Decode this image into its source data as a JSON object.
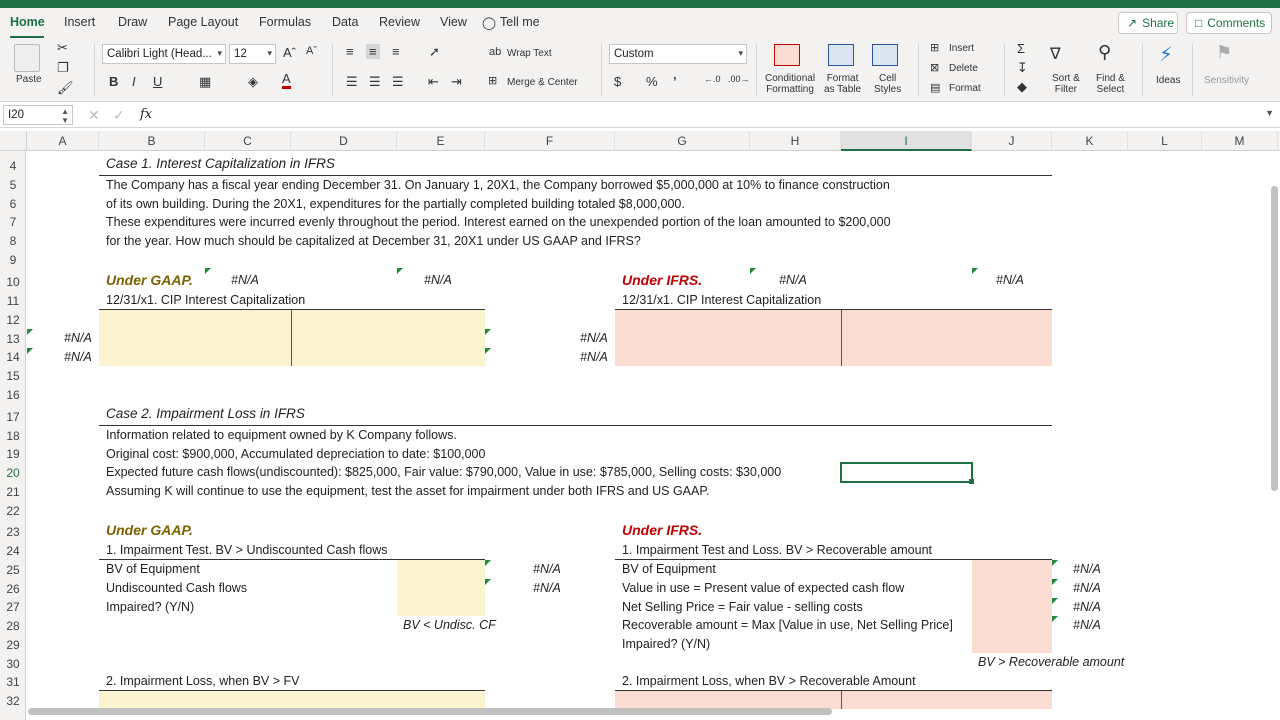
{
  "ribbon_tabs": [
    "Home",
    "Insert",
    "Draw",
    "Page Layout",
    "Formulas",
    "Data",
    "Review",
    "View"
  ],
  "tell_me": "Tell me",
  "share_label": "Share",
  "comments_label": "Comments",
  "ribbon": {
    "paste": "Paste",
    "font_name": "Calibri Light (Head...",
    "font_size": "12",
    "wrap_text": "Wrap Text",
    "merge_center": "Merge & Center",
    "number_format": "Custom",
    "conditional_formatting": [
      "Conditional",
      "Formatting"
    ],
    "format_as_table": [
      "Format",
      "as Table"
    ],
    "cell_styles": [
      "Cell",
      "Styles"
    ],
    "insert": "Insert",
    "delete": "Delete",
    "format": "Format",
    "sort_filter": [
      "Sort &",
      "Filter"
    ],
    "find_select": [
      "Find &",
      "Select"
    ],
    "ideas": "Ideas",
    "sensitivity": "Sensitivity"
  },
  "name_box": "I20",
  "fx": "fx",
  "columns": [
    "A",
    "B",
    "C",
    "D",
    "E",
    "F",
    "G",
    "H",
    "I",
    "J",
    "K",
    "L",
    "M"
  ],
  "rows": [
    "4",
    "5",
    "6",
    "7",
    "8",
    "9",
    "10",
    "11",
    "12",
    "13",
    "14",
    "15",
    "16",
    "17",
    "18",
    "19",
    "20",
    "21",
    "22",
    "23",
    "24",
    "25",
    "26",
    "27",
    "28",
    "29",
    "30",
    "31",
    "32"
  ],
  "sheet": {
    "case1_title": "Case 1. Interest Capitalization in IFRS",
    "case1_lines": [
      "The Company has a fiscal year ending December 31. On January 1, 20X1, the Company borrowed $5,000,000 at 10% to finance construction",
      "of its own building. During the 20X1, expenditures for the partially completed building totaled $8,000,000.",
      "These expenditures were incurred evenly throughout the period. Interest earned on the unexpended portion of the loan amounted to $200,000",
      "for the year. How much should be capitalized at December 31, 20X1 under US GAAP and IFRS?"
    ],
    "under_gaap": "Under GAAP.",
    "under_ifrs": "Under IFRS.",
    "na": "#N/A",
    "cip_label": "12/31/x1. CIP Interest Capitalization",
    "case2_title": "Case 2. Impairment Loss in IFRS",
    "case2_lines": [
      "Information related to equipment owned by K Company follows.",
      "Original cost: $900,000, Accumulated depreciation to date: $100,000",
      "Expected future cash flows(undiscounted): $825,000, Fair value: $790,000, Value in use: $785,000, Selling costs: $30,000",
      "Assuming K will continue to use the equipment, test the asset for impairment under both IFRS and US GAAP."
    ],
    "gaap_test_title": "1. Impairment Test. BV > Undiscounted Cash flows",
    "gaap_test_rows": [
      "BV of Equipment",
      "Undiscounted Cash flows",
      "Impaired? (Y/N)"
    ],
    "gaap_note": "BV < Undisc. CF",
    "ifrs_test_title": "1. Impairment Test and Loss. BV > Recoverable amount",
    "ifrs_test_rows": [
      "BV of Equipment",
      "Value in use = Present value of expected cash flow",
      "Net Selling Price = Fair value - selling costs",
      "Recoverable amount = Max [Value in use, Net Selling Price]",
      "Impaired? (Y/N)"
    ],
    "ifrs_note": "BV  > Recoverable amount",
    "gaap_loss_title": "2. Impairment Loss, when BV > FV",
    "ifrs_loss_title": "2. Impairment Loss, when BV > Recoverable Amount"
  }
}
